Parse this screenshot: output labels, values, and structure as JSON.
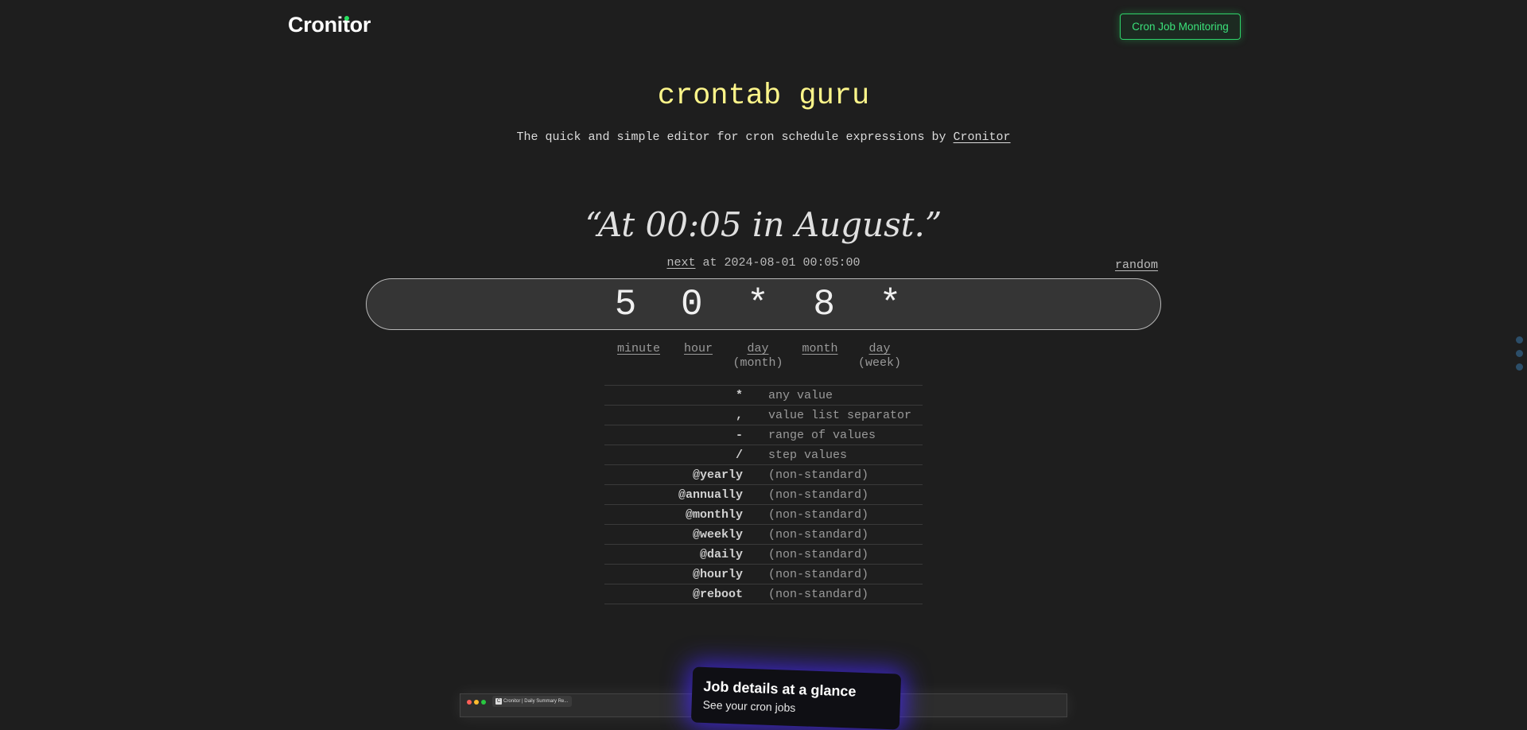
{
  "header": {
    "brand": "Cronitor",
    "cta_label": "Cron Job Monitoring",
    "accent": "#29e061"
  },
  "hero": {
    "title": "crontab guru",
    "subtitle_prefix": "The quick and simple editor for cron schedule expressions by",
    "subtitle_link": "Cronitor"
  },
  "editor": {
    "human_readable": "“At 00:05 in August.”",
    "next_label": "next",
    "next_text": "at 2024-08-01 00:05:00",
    "random_label": "random",
    "expression": "5 0 * 8 *"
  },
  "parts": [
    {
      "label": "minute",
      "sub": ""
    },
    {
      "label": "hour",
      "sub": ""
    },
    {
      "label": "day",
      "sub": "(month)"
    },
    {
      "label": "month",
      "sub": ""
    },
    {
      "label": "day",
      "sub": "(week)"
    }
  ],
  "legend": [
    {
      "symbol": "*",
      "desc": "any value"
    },
    {
      "symbol": ",",
      "desc": "value list separator"
    },
    {
      "symbol": "-",
      "desc": "range of values"
    },
    {
      "symbol": "/",
      "desc": "step values"
    },
    {
      "symbol": "@yearly",
      "desc": "(non-standard)"
    },
    {
      "symbol": "@annually",
      "desc": "(non-standard)"
    },
    {
      "symbol": "@monthly",
      "desc": "(non-standard)"
    },
    {
      "symbol": "@weekly",
      "desc": "(non-standard)"
    },
    {
      "symbol": "@daily",
      "desc": "(non-standard)"
    },
    {
      "symbol": "@hourly",
      "desc": "(non-standard)"
    },
    {
      "symbol": "@reboot",
      "desc": "(non-standard)"
    }
  ],
  "promo": {
    "card_heading": "Job details at a glance",
    "card_sub": "See your cron jobs",
    "tab_label": "Cronitor | Daily Summary Re..."
  }
}
